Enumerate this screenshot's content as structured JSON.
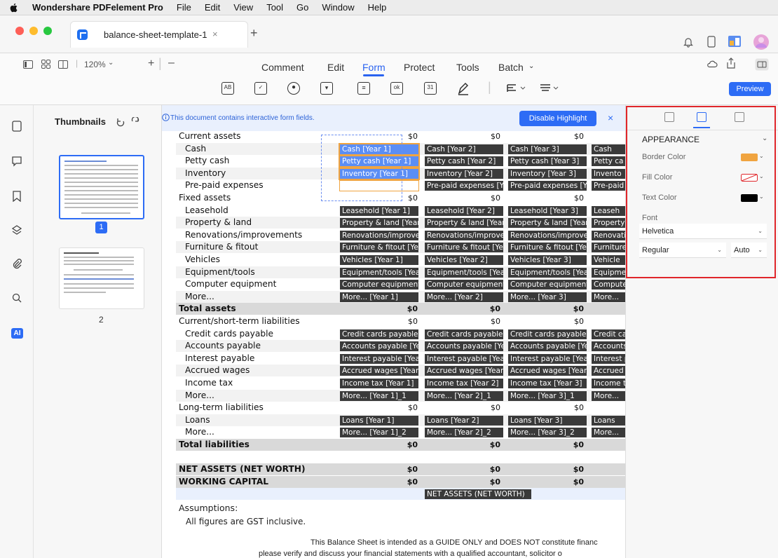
{
  "menubar": {
    "app_name": "Wondershare PDFelement Pro",
    "items": [
      "File",
      "Edit",
      "View",
      "Tool",
      "Go",
      "Window",
      "Help"
    ]
  },
  "tabbar": {
    "doc_tab": "balance-sheet-template-1",
    "close": "×",
    "new_tab": "+"
  },
  "toolbar": {
    "zoom": "120%",
    "zoom_minus": "–",
    "zoom_plus": "+",
    "tabs": [
      "Comment",
      "Edit",
      "Form",
      "Protect",
      "Tools",
      "Batch"
    ],
    "active_tab": "Form",
    "preview": "Preview"
  },
  "thumbnails": {
    "title": "Thumbnails",
    "page1": "1",
    "page2": "2"
  },
  "banner": {
    "message": "This document contains interactive form fields.",
    "disable_button": "Disable Highlight",
    "close": "×"
  },
  "sheet": {
    "header_values": [
      "$0",
      "$0",
      "$0"
    ],
    "rows": [
      {
        "label": "Current assets",
        "kind": "section",
        "vals": [
          "$0",
          "$0",
          "$0"
        ]
      },
      {
        "label": "Cash",
        "kind": "item",
        "fields": [
          "Cash [Year 1]",
          "Cash [Year 2]",
          "Cash [Year 3]",
          "Cash"
        ]
      },
      {
        "label": "Petty cash",
        "kind": "item",
        "fields": [
          "Petty cash [Year 1]",
          "Petty cash [Year 2]",
          "Petty cash [Year 3]",
          "Petty ca"
        ]
      },
      {
        "label": "Inventory",
        "kind": "item",
        "fields": [
          "Inventory [Year 1]",
          "Inventory [Year 2]",
          "Inventory [Year 3]",
          "Invento"
        ]
      },
      {
        "label": "Pre-paid expenses",
        "kind": "item",
        "fields": [
          "",
          "Pre-paid expenses [Y",
          "Pre-paid expenses [Y",
          "Pre-paid exp"
        ]
      },
      {
        "label": "Fixed assets",
        "kind": "section",
        "vals": [
          "$0",
          "$0",
          "$0"
        ]
      },
      {
        "label": "Leasehold",
        "kind": "item",
        "fields": [
          "Leasehold [Year 1]",
          "Leasehold [Year 2]",
          "Leasehold [Year 3]",
          "Leaseh"
        ]
      },
      {
        "label": "Property & land",
        "kind": "item",
        "fields": [
          "Property & land [Year",
          "Property & land [Year",
          "Property & land [Year",
          "Property &"
        ]
      },
      {
        "label": "Renovations/improvements",
        "kind": "item",
        "fields": [
          "Renovations/improven",
          "Renovations/improver",
          "Renovations/improven",
          "Renovations/imp"
        ]
      },
      {
        "label": "Furniture & fitout",
        "kind": "item",
        "fields": [
          "Furniture & fitout [Yea",
          "Furniture & fitout [Yea",
          "Furniture & fitout [Yea",
          "Furniture &"
        ]
      },
      {
        "label": "Vehicles",
        "kind": "item",
        "fields": [
          "Vehicles [Year 1]",
          "Vehicles [Year 2]",
          "Vehicles [Year 3]",
          "Vehicle"
        ]
      },
      {
        "label": "Equipment/tools",
        "kind": "item",
        "fields": [
          "Equipment/tools [Year",
          "Equipment/tools [Year",
          "Equipment/tools [Year",
          "Equipment"
        ]
      },
      {
        "label": "Computer equipment",
        "kind": "item",
        "fields": [
          "Computer equipment [",
          "Computer equipment",
          "Computer equipment",
          "Computer equ"
        ]
      },
      {
        "label": "More...",
        "kind": "item",
        "fields": [
          "More... [Year 1]",
          "More... [Year 2]",
          "More... [Year 3]",
          "More..."
        ]
      },
      {
        "label": "Total assets",
        "kind": "total",
        "vals": [
          "$0",
          "$0",
          "$0"
        ]
      },
      {
        "label": "Current/short-term liabilities",
        "kind": "section",
        "vals": [
          "$0",
          "$0",
          "$0"
        ]
      },
      {
        "label": "Credit cards payable",
        "kind": "item",
        "fields": [
          "Credit cards payable [",
          "Credit cards payable [",
          "Credit cards payable [",
          "Credit cards"
        ]
      },
      {
        "label": "Accounts payable",
        "kind": "item",
        "fields": [
          "Accounts payable [Ye",
          "Accounts payable [Ye",
          "Accounts payable [Ye",
          "Accounts pa"
        ]
      },
      {
        "label": "Interest payable",
        "kind": "item",
        "fields": [
          "Interest payable [Year",
          "Interest payable [Year",
          "Interest payable [Year",
          "Interest pay"
        ]
      },
      {
        "label": "Accrued wages",
        "kind": "item",
        "fields": [
          "Accrued wages [Year",
          "Accrued wages [Year",
          "Accrued wages [Year",
          "Accrued wa"
        ]
      },
      {
        "label": "Income tax",
        "kind": "item",
        "fields": [
          "Income tax [Year 1]",
          "Income tax [Year 2]",
          "Income tax [Year 3]",
          "Income t"
        ]
      },
      {
        "label": "More...",
        "kind": "item",
        "fields": [
          "More... [Year 1]_1",
          "More... [Year 2]_1",
          "More... [Year 3]_1",
          "More..."
        ]
      },
      {
        "label": "Long-term liabilities",
        "kind": "section",
        "vals": [
          "$0",
          "$0",
          "$0"
        ]
      },
      {
        "label": "Loans",
        "kind": "item",
        "fields": [
          "Loans [Year 1]",
          "Loans [Year 2]",
          "Loans [Year 3]",
          "Loans"
        ]
      },
      {
        "label": "More...",
        "kind": "item",
        "fields": [
          "More... [Year 1]_2",
          "More... [Year 2]_2",
          "More... [Year 3]_2",
          "More..."
        ]
      },
      {
        "label": "Total liabilities",
        "kind": "total",
        "vals": [
          "$0",
          "$0",
          "$0"
        ]
      },
      {
        "label": "",
        "kind": "blank"
      },
      {
        "label": "NET ASSETS (NET WORTH)",
        "kind": "total",
        "vals": [
          "$0",
          "$0",
          "$0"
        ]
      },
      {
        "label": "WORKING CAPITAL",
        "kind": "total",
        "vals": [
          "$0",
          "$0",
          "$0"
        ]
      },
      {
        "label": "",
        "kind": "netfield",
        "field": "NET ASSETS (NET WORTH)"
      }
    ],
    "assumptions_title": "Assumptions:",
    "assumptions_text": "All figures are GST inclusive.",
    "disclaimer1": "This Balance Sheet is intended as a GUIDE ONLY and DOES NOT constitute financ",
    "disclaimer2": "please verify and discuss your financial statements with a qualified accountant, solicitor o"
  },
  "panel": {
    "section": "APPEARANCE",
    "border_color_label": "Border Color",
    "fill_color_label": "Fill Color",
    "text_color_label": "Text Color",
    "font_label": "Font",
    "font_value": "Helvetica",
    "style_value": "Regular",
    "size_value": "Auto",
    "colors": {
      "border": "#f0a440",
      "fill": "none-red-slash",
      "text": "#000000"
    }
  },
  "colors": {
    "accent": "#2d6cf5",
    "highlight": "#e0262b"
  }
}
